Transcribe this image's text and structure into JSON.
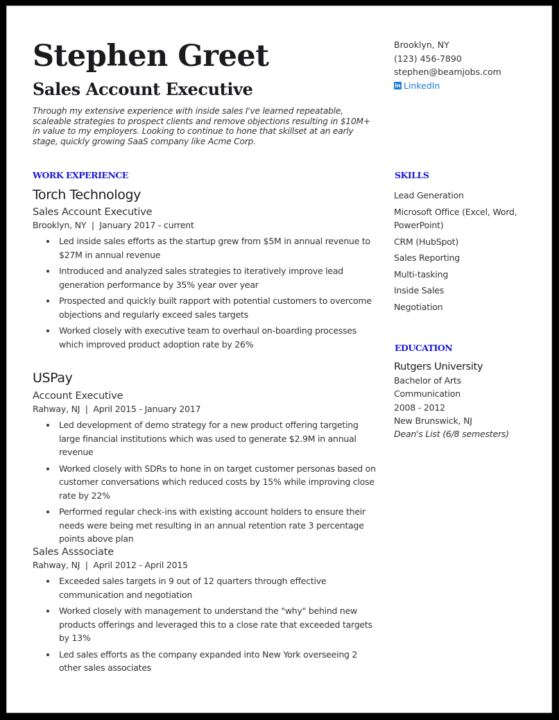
{
  "header": {
    "name": "Stephen Greet",
    "title": "Sales Account Executive",
    "summary": "Through my extensive experience with inside sales I've learned repeatable, scaleable strategies to prospect clients and remove objections resulting in $10M+ in value to my employers. Looking to continue to hone that skillset at an early stage, quickly growing SaaS company like Acme Corp."
  },
  "contact": {
    "location": "Brooklyn, NY",
    "phone": "(123) 456-7890",
    "email": "stephen@beamjobs.com",
    "linkedin_icon": "in",
    "linkedin_label": "LinkedIn",
    "linkedin_color": "#1f7bd6"
  },
  "work": {
    "heading": "WORK EXPERIENCE",
    "heading_color": "#1a1ad6",
    "jobs": [
      {
        "company": "Torch Technology",
        "role": "Sales Account Executive",
        "meta": "Brooklyn, NY  |  January 2017 - current",
        "bullets": [
          "Led inside sales efforts as the startup grew from $5M in annual revenue to $27M in annual revenue",
          "Introduced and analyzed sales strategies to iteratively improve lead generation performance by 35% year over year",
          "Prospected and quickly built rapport with potential customers to overcome objections and regularly exceed sales targets",
          "Worked closely with executive team to overhaul on-boarding processes which improved product adoption rate by 26%"
        ]
      },
      {
        "company": "USPay",
        "role": "Account Executive",
        "meta": "Rahway, NJ  |  April 2015 - January 2017",
        "bullets": [
          "Led development of demo strategy for a new product offering targeting large financial institutions which was used to generate $2.9M in annual revenue",
          "Worked closely with SDRs to hone in on target customer personas based on customer conversations which reduced costs by 15% while improving close rate by 22%",
          "Performed regular check-ins with existing account holders to ensure their needs were being met resulting in an annual retention rate 3 percentage points above plan"
        ]
      },
      {
        "company": "",
        "role": "Sales Asssociate",
        "meta": "Rahway, NJ  |  April 2012 - April 2015",
        "bullets": [
          "Exceeded sales targets in 9 out of 12 quarters through effective communication and negotiation",
          "Worked closely with management to understand the \"why\" behind new products offerings and leveraged this to a close rate that exceeded targets by 13%",
          "Led sales efforts as the company expanded into New York overseeing 2 other sales associates"
        ]
      }
    ]
  },
  "skills": {
    "heading": "SKILLS",
    "items": [
      "Lead Generation",
      "Microsoft Office (Excel, Word, PowerPoint)",
      "CRM (HubSpot)",
      "Sales Reporting",
      "Multi-tasking",
      "Inside Sales",
      "Negotiation"
    ]
  },
  "education": {
    "heading": "EDUCATION",
    "school": "Rutgers University",
    "degree": "Bachelor of Arts",
    "field": "Communication",
    "years": "2008 - 2012",
    "location": "New Brunswick, NJ",
    "honors": "Dean's List (6/8 semesters)"
  }
}
